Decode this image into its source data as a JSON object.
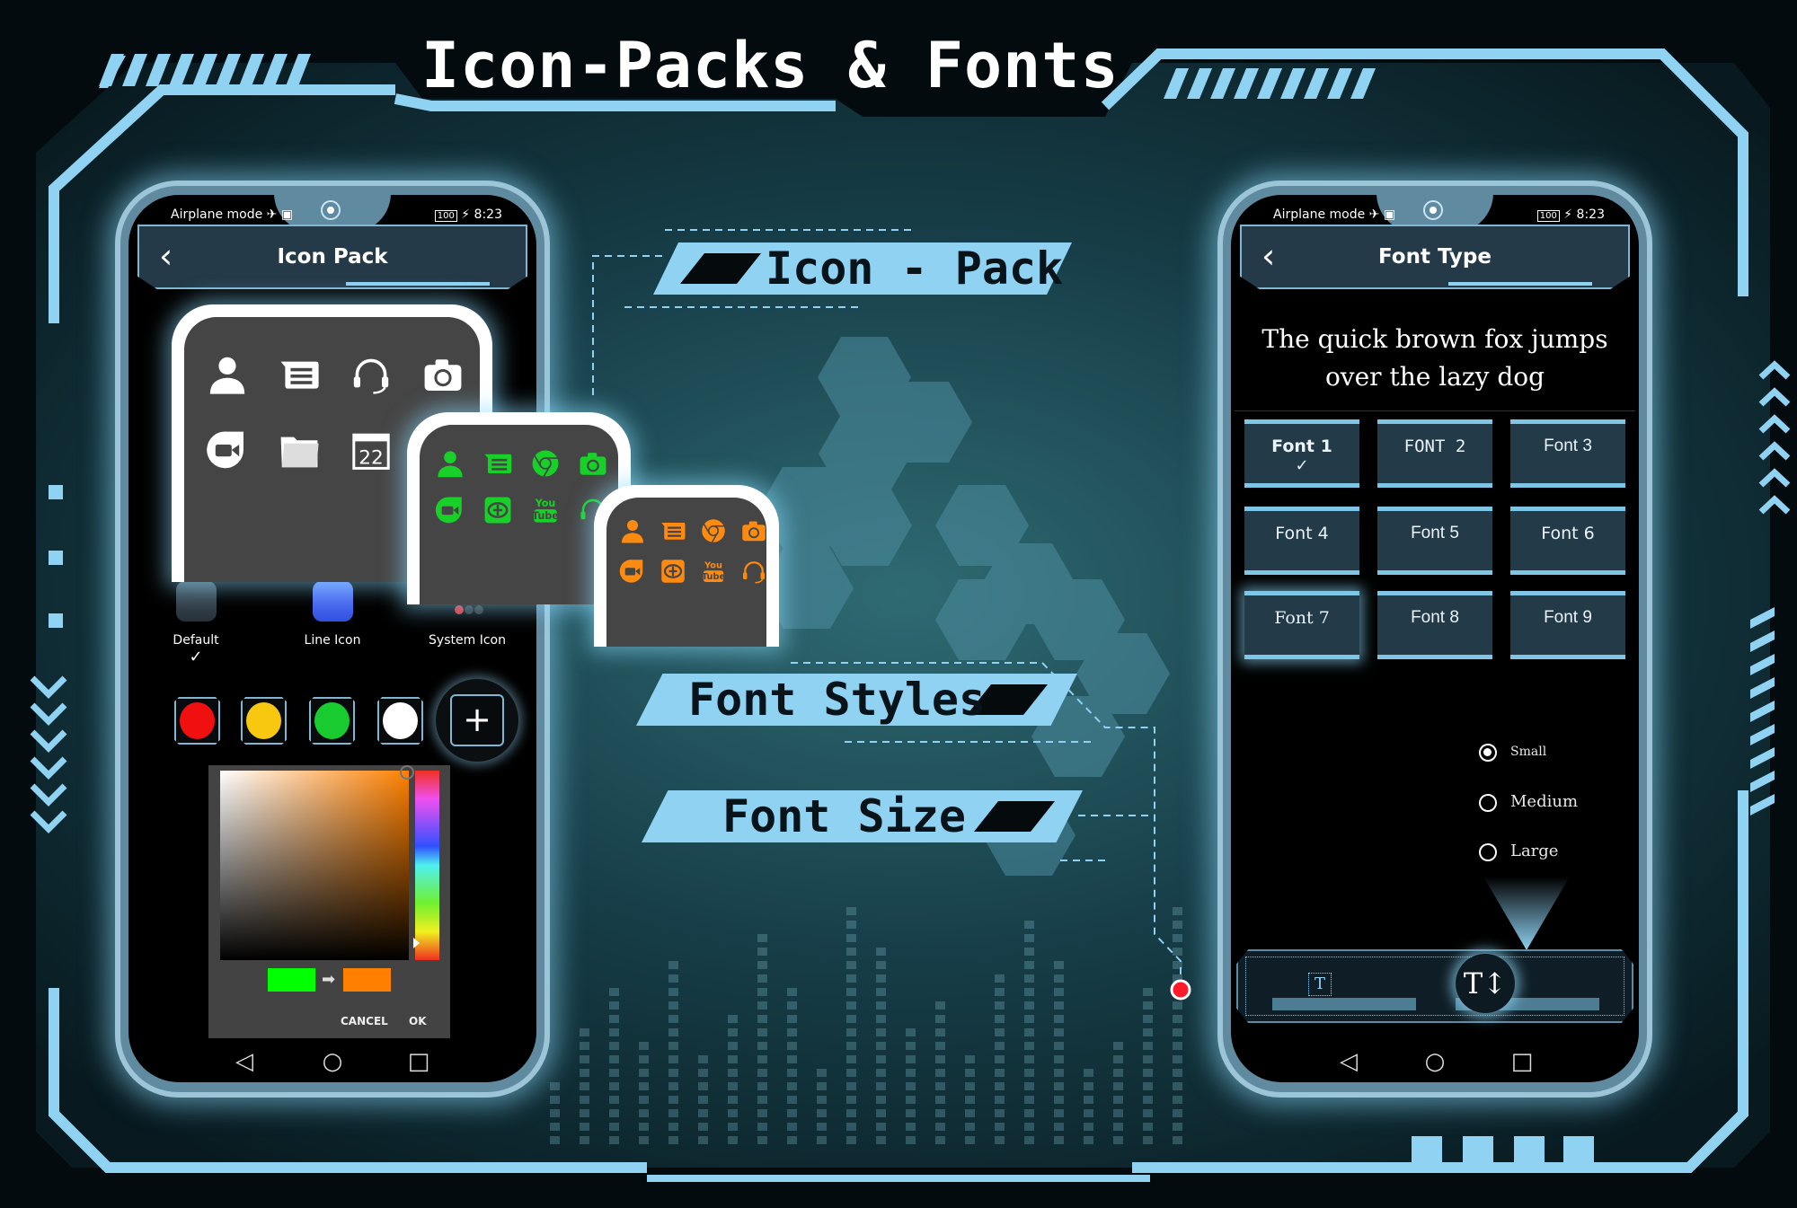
{
  "title": "Icon-Packs & Fonts",
  "banners": {
    "icon_pack": "Icon - Pack",
    "font_styles": "Font Styles",
    "font_size": "Font Size"
  },
  "colors": {
    "accent": "#8fd2f2",
    "background": "#1d4a55",
    "panel": "#243a48"
  },
  "status_bar": {
    "left": "Airplane mode ✈ ▣",
    "battery": "100",
    "time": "⚡ 8:23"
  },
  "left_phone": {
    "header_title": "Icon Pack",
    "back_icon": "chevron-left-icon",
    "preview_icons_white": [
      "person-icon",
      "message-icon",
      "headset-icon",
      "camera-icon",
      "video-icon",
      "folder-icon",
      "calendar-icon"
    ],
    "calendar_day": "22",
    "preview_icons_green": [
      "person-icon",
      "message-icon",
      "chrome-icon",
      "camera-icon",
      "video-icon",
      "cashback-icon",
      "youtube-icon",
      "headset-icon"
    ],
    "preview_icons_orange": [
      "person-icon",
      "message-icon",
      "chrome-icon",
      "camera-icon",
      "video-icon",
      "cashback-icon",
      "youtube-icon",
      "headset-icon"
    ],
    "youtube_lettering": [
      "You",
      "Tube"
    ],
    "icon_pack_options": [
      {
        "label": "Default",
        "selected": true
      },
      {
        "label": "Line Icon",
        "selected": false
      },
      {
        "label": "System Icon",
        "selected": false
      }
    ],
    "check_mark": "✓",
    "swatches": [
      "#f01010",
      "#f8c810",
      "#18cc30",
      "#ffffff"
    ],
    "add_color_label": "+",
    "color_picker": {
      "selected_hue_color": "#ff8000",
      "old_color": "#00ff00",
      "new_color": "#ff8000",
      "cancel_label": "CANCEL",
      "ok_label": "OK"
    },
    "nav": [
      "◁",
      "○",
      "□"
    ]
  },
  "right_phone": {
    "header_title": "Font Type",
    "sample_text": "The quick brown fox jumps over the lazy dog",
    "fonts": [
      {
        "label": "Font 1",
        "selected": true
      },
      {
        "label": "FONT 2",
        "selected": false
      },
      {
        "label": "Font 3",
        "selected": false
      },
      {
        "label": "Font 4",
        "selected": false
      },
      {
        "label": "Font 5",
        "selected": false
      },
      {
        "label": "Font 6",
        "selected": false
      },
      {
        "label": "Font 7",
        "selected": false,
        "focused": true
      },
      {
        "label": "Font 8",
        "selected": false
      },
      {
        "label": "Font 9",
        "selected": false
      }
    ],
    "check_mark": "✓",
    "sizes": [
      {
        "label": "Small",
        "selected": true
      },
      {
        "label": "Medium",
        "selected": false
      },
      {
        "label": "Large",
        "selected": false
      }
    ],
    "bottom_tabs": [
      {
        "icon": "text-box-icon",
        "glyph": "T",
        "active": false
      },
      {
        "icon": "text-size-icon",
        "glyph": "T↕",
        "active": true
      }
    ],
    "nav": [
      "◁",
      "○",
      "□"
    ]
  }
}
